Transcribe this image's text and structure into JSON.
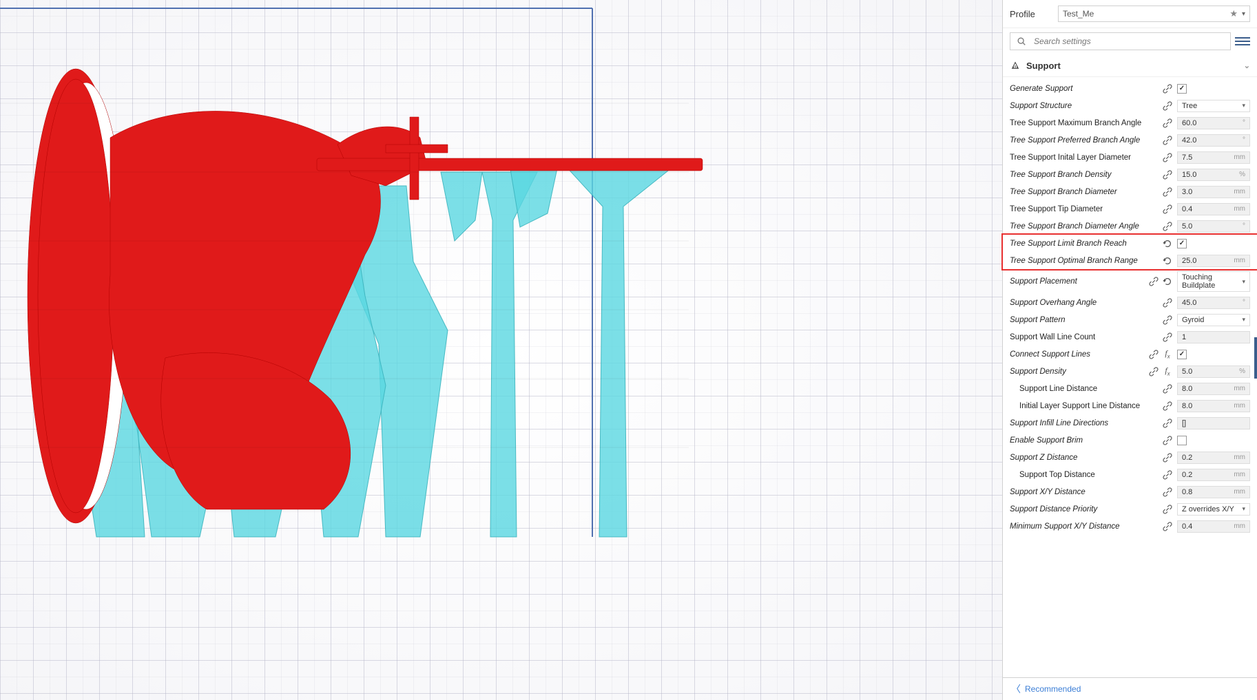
{
  "profile": {
    "label": "Profile",
    "name": "Test_Me"
  },
  "search": {
    "placeholder": "Search settings"
  },
  "section": {
    "title": "Support"
  },
  "settings": [
    {
      "key": "generate_support",
      "label": "Generate Support",
      "type": "checkbox",
      "checked": true,
      "link": true,
      "italic": true
    },
    {
      "key": "support_structure",
      "label": "Support Structure",
      "type": "dropdown",
      "value": "Tree",
      "link": true,
      "italic": true
    },
    {
      "key": "tree_max_branch_angle",
      "label": "Tree Support Maximum Branch Angle",
      "type": "number",
      "value": "60.0",
      "unit": "°",
      "link": true
    },
    {
      "key": "tree_pref_branch_angle",
      "label": "Tree Support Preferred Branch Angle",
      "type": "number",
      "value": "42.0",
      "unit": "°",
      "link": true,
      "italic": true
    },
    {
      "key": "tree_initial_layer_diameter",
      "label": "Tree Support Inital Layer Diameter",
      "type": "number",
      "value": "7.5",
      "unit": "mm",
      "link": true
    },
    {
      "key": "tree_branch_density",
      "label": "Tree Support Branch Density",
      "type": "number",
      "value": "15.0",
      "unit": "%",
      "link": true,
      "italic": true
    },
    {
      "key": "tree_branch_diameter",
      "label": "Tree Support Branch Diameter",
      "type": "number",
      "value": "3.0",
      "unit": "mm",
      "link": true,
      "italic": true
    },
    {
      "key": "tree_tip_diameter",
      "label": "Tree Support Tip Diameter",
      "type": "number",
      "value": "0.4",
      "unit": "mm",
      "link": true
    },
    {
      "key": "tree_branch_diameter_angle",
      "label": "Tree Support Branch Diameter Angle",
      "type": "number",
      "value": "5.0",
      "unit": "°",
      "link": true,
      "italic": true
    },
    {
      "key": "tree_limit_branch_reach",
      "label": "Tree Support Limit Branch Reach",
      "type": "checkbox",
      "checked": true,
      "reset": true,
      "italic": true,
      "highlight": "start"
    },
    {
      "key": "tree_optimal_branch_range",
      "label": "Tree Support Optimal Branch Range",
      "type": "number",
      "value": "25.0",
      "unit": "mm",
      "reset": true,
      "italic": true,
      "highlight": "end"
    },
    {
      "key": "support_placement",
      "label": "Support Placement",
      "type": "dropdown",
      "value": "Touching Buildplate",
      "link": true,
      "reset": true,
      "italic": true
    },
    {
      "key": "support_overhang_angle",
      "label": "Support Overhang Angle",
      "type": "number",
      "value": "45.0",
      "unit": "°",
      "link": true,
      "italic": true
    },
    {
      "key": "support_pattern",
      "label": "Support Pattern",
      "type": "dropdown",
      "value": "Gyroid",
      "link": true,
      "italic": true
    },
    {
      "key": "support_wall_line_count",
      "label": "Support Wall Line Count",
      "type": "number",
      "value": "1",
      "unit": "",
      "link": true
    },
    {
      "key": "connect_support_lines",
      "label": "Connect Support Lines",
      "type": "checkbox",
      "checked": true,
      "link": true,
      "fx": true,
      "italic": true
    },
    {
      "key": "support_density",
      "label": "Support Density",
      "type": "number",
      "value": "5.0",
      "unit": "%",
      "link": true,
      "fx": true,
      "italic": true
    },
    {
      "key": "support_line_distance",
      "label": "Support Line Distance",
      "type": "number",
      "value": "8.0",
      "unit": "mm",
      "link": true,
      "indent": 1
    },
    {
      "key": "initial_layer_support_line_distance",
      "label": "Initial Layer Support Line Distance",
      "type": "number",
      "value": "8.0",
      "unit": "mm",
      "link": true,
      "indent": 1
    },
    {
      "key": "support_infill_line_directions",
      "label": "Support Infill Line Directions",
      "type": "number",
      "value": "[]",
      "unit": "",
      "link": true,
      "italic": true
    },
    {
      "key": "enable_support_brim",
      "label": "Enable Support Brim",
      "type": "checkbox",
      "checked": false,
      "link": true,
      "italic": true
    },
    {
      "key": "support_z_distance",
      "label": "Support Z Distance",
      "type": "number",
      "value": "0.2",
      "unit": "mm",
      "link": true,
      "italic": true
    },
    {
      "key": "support_top_distance",
      "label": "Support Top Distance",
      "type": "number",
      "value": "0.2",
      "unit": "mm",
      "link": true,
      "indent": 1
    },
    {
      "key": "support_xy_distance",
      "label": "Support X/Y Distance",
      "type": "number",
      "value": "0.8",
      "unit": "mm",
      "link": true,
      "italic": true
    },
    {
      "key": "support_distance_priority",
      "label": "Support Distance Priority",
      "type": "dropdown",
      "value": "Z overrides X/Y",
      "link": true,
      "italic": true
    },
    {
      "key": "minimum_support_xy_distance",
      "label": "Minimum Support X/Y Distance",
      "type": "number",
      "value": "0.4",
      "unit": "mm",
      "link": true,
      "italic": true
    }
  ],
  "footer": {
    "label": "Recommended"
  }
}
